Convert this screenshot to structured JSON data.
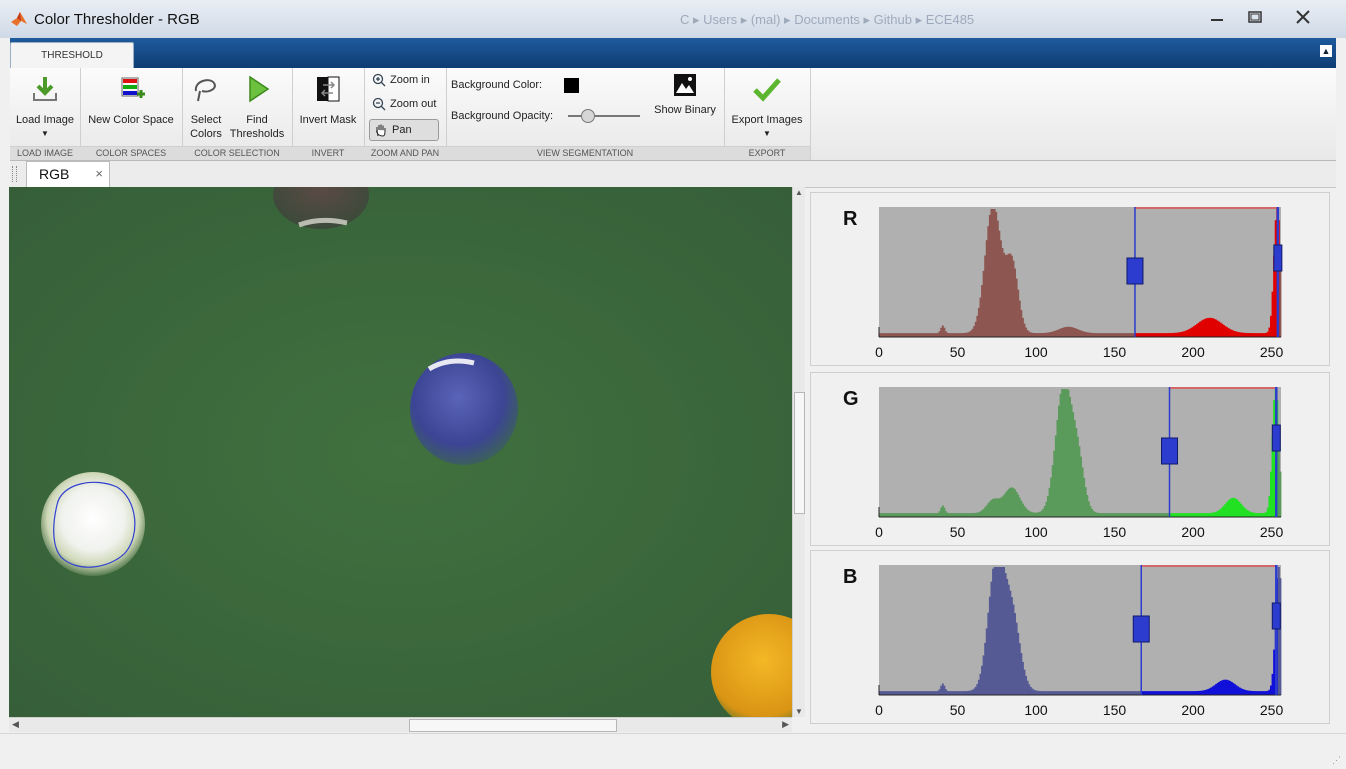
{
  "window": {
    "title": "Color Thresholder - RGB",
    "background_ghost_path": "C ▸ Users ▸ (mal) ▸ Documents ▸ Github ▸ ECE485"
  },
  "toolstrip": {
    "tab_label": "THRESHOLD",
    "sections": [
      {
        "caption": "LOAD IMAGE",
        "buttons": [
          {
            "label": "Load Image"
          }
        ]
      },
      {
        "caption": "COLOR SPACES",
        "buttons": [
          {
            "label": "New Color Space"
          }
        ]
      },
      {
        "caption": "COLOR SELECTION",
        "buttons": [
          {
            "label": "Select Colors"
          },
          {
            "label": "Find Thresholds"
          }
        ]
      },
      {
        "caption": "INVERT",
        "buttons": [
          {
            "label": "Invert Mask"
          }
        ]
      },
      {
        "caption": "ZOOM AND PAN",
        "buttons": [
          {
            "label": "Zoom in"
          },
          {
            "label": "Zoom out"
          },
          {
            "label": "Pan"
          }
        ]
      },
      {
        "caption": "VIEW SEGMENTATION",
        "background_color_label": "Background Color:",
        "background_opacity_label": "Background Opacity:",
        "opacity_value": 0.2,
        "show_binary_label": "Show Binary"
      },
      {
        "caption": "EXPORT",
        "buttons": [
          {
            "label": "Export Images"
          }
        ]
      }
    ]
  },
  "document_tab": {
    "label": "RGB",
    "close": "×"
  },
  "colors": {
    "ribbon_blue": "#1a4f8c",
    "threshold_handle": "#2b3ccf",
    "range_line": "#e05050",
    "background_swatch": "#000000"
  },
  "channels": [
    {
      "label": "R",
      "low": 163,
      "high": 254,
      "fill_low": "#8e5650",
      "fill_high": "#e00000"
    },
    {
      "label": "G",
      "low": 185,
      "high": 253,
      "fill_low": "#5a9a5a",
      "fill_high": "#22e022"
    },
    {
      "label": "B",
      "low": 167,
      "high": 253,
      "fill_low": "#565a94",
      "fill_high": "#1010d8"
    }
  ],
  "axis_ticks": [
    "0",
    "50",
    "100",
    "150",
    "200",
    "250"
  ]
}
